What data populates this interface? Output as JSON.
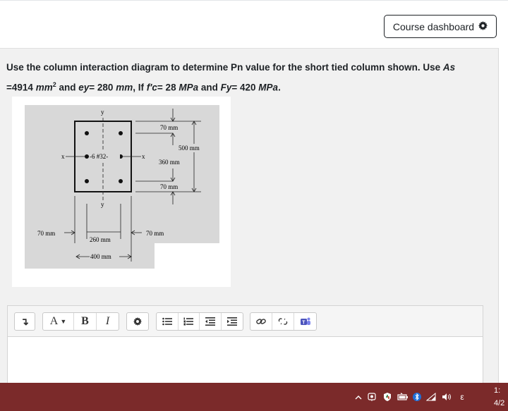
{
  "header": {
    "course_dashboard_label": "Course dashboard",
    "gear_icon": "gear-icon"
  },
  "question": {
    "line1_prefix": "Use the column interaction diagram to determine Pn value for the short tied column shown. Use ",
    "as_var": "As",
    "line2_as_value": "=4914",
    "mm_unit": "mm",
    "sup2": "2",
    "and_ey": " and ",
    "ey_var": "ey",
    "ey_value": "= 280 ",
    "ey_unit": "mm",
    "if_text": ", If ",
    "fc_var": "f'c",
    "fc_value": "= 28 ",
    "fc_unit": "MPa",
    "and_fy": " and ",
    "fy_var": "Fy",
    "fy_value": "= 420 ",
    "fy_unit": "MPa",
    "end": "."
  },
  "figure": {
    "label_y_top": "y",
    "label_y_bottom": "y",
    "label_x_left": "x",
    "label_x_right": "x",
    "bars_label": "-6 #32-",
    "dim_70_top": "70 mm",
    "dim_500": "500 mm",
    "dim_360": "360 mm",
    "dim_70_bottom": "70 mm",
    "dim_70_left": "70 mm",
    "dim_70_right": "70 mm",
    "dim_260": "260 mm",
    "dim_400": "400 mm"
  },
  "toolbar": {
    "collapse_label": "↴",
    "font_label": "A",
    "bold_label": "B",
    "italic_label": "I",
    "icons": [
      "collapse-icon",
      "font-color-icon",
      "bold-icon",
      "italic-icon",
      "settings-icon",
      "unordered-list-icon",
      "ordered-list-icon",
      "outdent-icon",
      "indent-icon",
      "link-icon",
      "unlink-icon",
      "teams-icon"
    ]
  },
  "editor": {
    "value": ""
  },
  "taskbar": {
    "clock_time": "1:",
    "clock_date": "4/2",
    "lang": "ε"
  }
}
